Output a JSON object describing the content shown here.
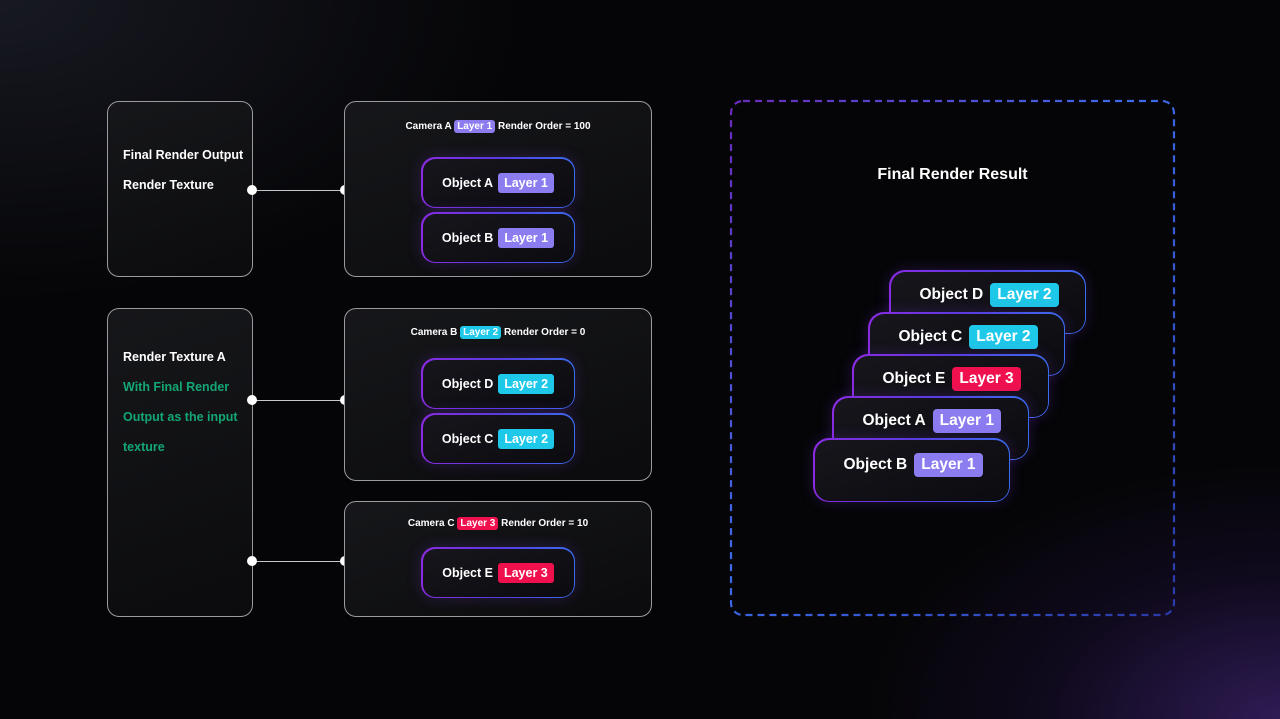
{
  "colors": {
    "layer1": "#8b7cf0",
    "layer2": "#1ec8e8",
    "layer3": "#f0104e",
    "green_text": "#13a774"
  },
  "sources": [
    {
      "lines": [
        "Final Render Output",
        "Render Texture"
      ],
      "highlight_lines": []
    },
    {
      "lines": [
        "Render Texture A",
        "With Final Render",
        "Output as the input",
        "texture"
      ],
      "highlight_lines": [
        1,
        2,
        3
      ]
    }
  ],
  "cameras": [
    {
      "name": "Camera A",
      "layer": "Layer 1",
      "render_order_label": "Render Order = 100",
      "objects": [
        {
          "name": "Object A",
          "layer": "Layer 1"
        },
        {
          "name": "Object B",
          "layer": "Layer 1"
        }
      ]
    },
    {
      "name": "Camera B",
      "layer": "Layer 2",
      "render_order_label": "Render Order = 0",
      "objects": [
        {
          "name": "Object D",
          "layer": "Layer 2"
        },
        {
          "name": "Object C",
          "layer": "Layer 2"
        }
      ]
    },
    {
      "name": "Camera C",
      "layer": "Layer 3",
      "render_order_label": "Render Order = 10",
      "objects": [
        {
          "name": "Object E",
          "layer": "Layer 3"
        }
      ]
    }
  ],
  "connections": [
    {
      "from": "Final Render Output / Render Texture",
      "to": "Camera A"
    },
    {
      "from": "Render Texture A",
      "to": "Camera B"
    },
    {
      "from": "Render Texture A",
      "to": "Camera C"
    }
  ],
  "result": {
    "title": "Final Render Result",
    "stack_back_to_front": [
      {
        "name": "Object D",
        "layer": "Layer 2"
      },
      {
        "name": "Object C",
        "layer": "Layer 2"
      },
      {
        "name": "Object E",
        "layer": "Layer 3"
      },
      {
        "name": "Object A",
        "layer": "Layer 1"
      },
      {
        "name": "Object B",
        "layer": "Layer 1"
      }
    ]
  }
}
